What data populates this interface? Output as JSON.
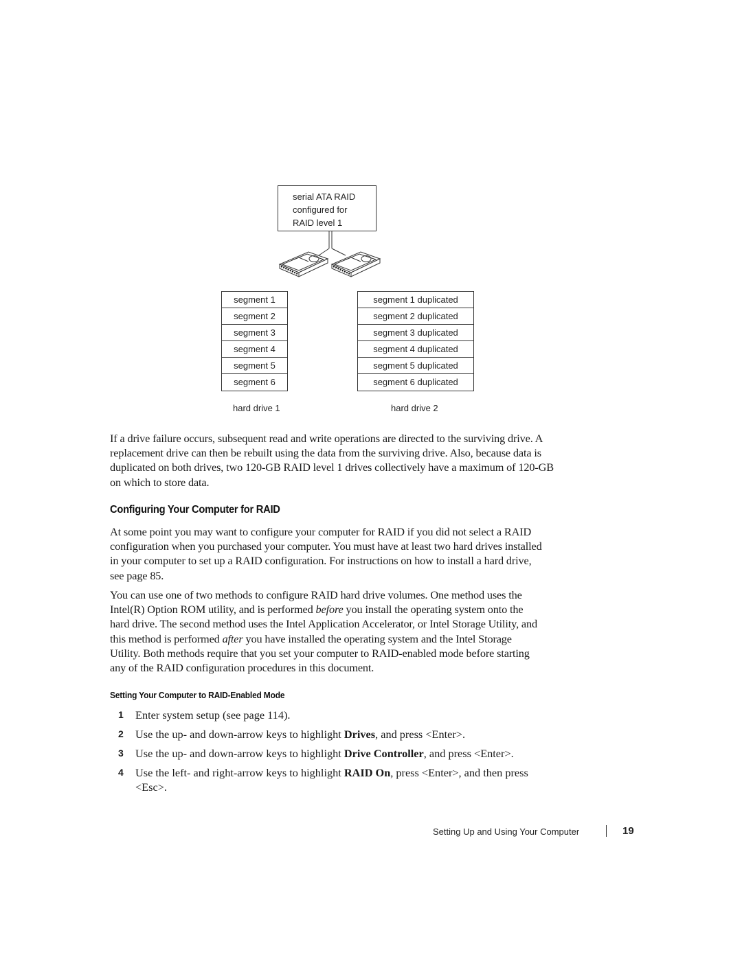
{
  "diagram": {
    "controller_label_lines": [
      "serial ATA RAID",
      "configured for",
      "RAID level 1"
    ],
    "drives": [
      {
        "label": "hard drive 1",
        "segments": [
          "segment 1",
          "segment 2",
          "segment 3",
          "segment 4",
          "segment 5",
          "segment 6"
        ]
      },
      {
        "label": "hard drive 2",
        "segments": [
          "segment 1 duplicated",
          "segment 2 duplicated",
          "segment 3 duplicated",
          "segment 4 duplicated",
          "segment 5 duplicated",
          "segment 6 duplicated"
        ]
      }
    ],
    "icons": [
      "hard-drive-icon",
      "hard-drive-icon"
    ]
  },
  "paragraphs": {
    "p1_lines": [
      "If a drive failure occurs, subsequent read and write operations are directed to the surviving drive. A",
      "replacement drive can then be rebuilt using the data from the surviving drive. Also, because data is",
      "duplicated on both drives, two 120-GB RAID level 1 drives collectively have a maximum of 120-GB",
      "on which to store data."
    ],
    "section_heading": "Configuring Your Computer for RAID",
    "p2_lines": [
      "At some point you may want to configure your computer for RAID if you did not select a RAID",
      "configuration when you purchased your computer. You must have at least two hard drives installed",
      "in your computer to set up a RAID configuration. For instructions on how to install a hard drive,",
      "see page 85."
    ],
    "p3": {
      "line1": "You can use one of two methods to configure RAID hard drive volumes. One method uses the",
      "line2_before": "Intel(R) Option ROM utility, and is performed ",
      "line2_em": "before",
      "line2_after": " you install the operating system onto the",
      "line3": "hard drive. The second method uses the Intel Application Accelerator, or Intel Storage Utility, and",
      "line4_before": "this method is performed ",
      "line4_em": "after",
      "line4_after": " you have installed the operating system and the Intel Storage",
      "line5": "Utility. Both methods require that you set your computer to RAID-enabled mode before starting",
      "line6": "any of the RAID configuration procedures in this document."
    },
    "subsection_heading": "Setting Your Computer to RAID-Enabled Mode"
  },
  "steps": [
    {
      "num": "1",
      "text": "Enter system setup (see page 114)."
    },
    {
      "num": "2",
      "before": "Use the up- and down-arrow keys to highlight ",
      "bold": "Drives",
      "after": ", and press <Enter>."
    },
    {
      "num": "3",
      "before": "Use the up- and down-arrow keys to highlight ",
      "bold": "Drive Controller",
      "after": ", and press <Enter>."
    },
    {
      "num": "4",
      "before": "Use the left- and right-arrow keys to highlight ",
      "bold": "RAID On",
      "after": ", press <Enter>, and then press",
      "line2": "<Esc>."
    }
  ],
  "footer": {
    "title": "Setting Up and Using Your Computer",
    "page_number": "19"
  }
}
